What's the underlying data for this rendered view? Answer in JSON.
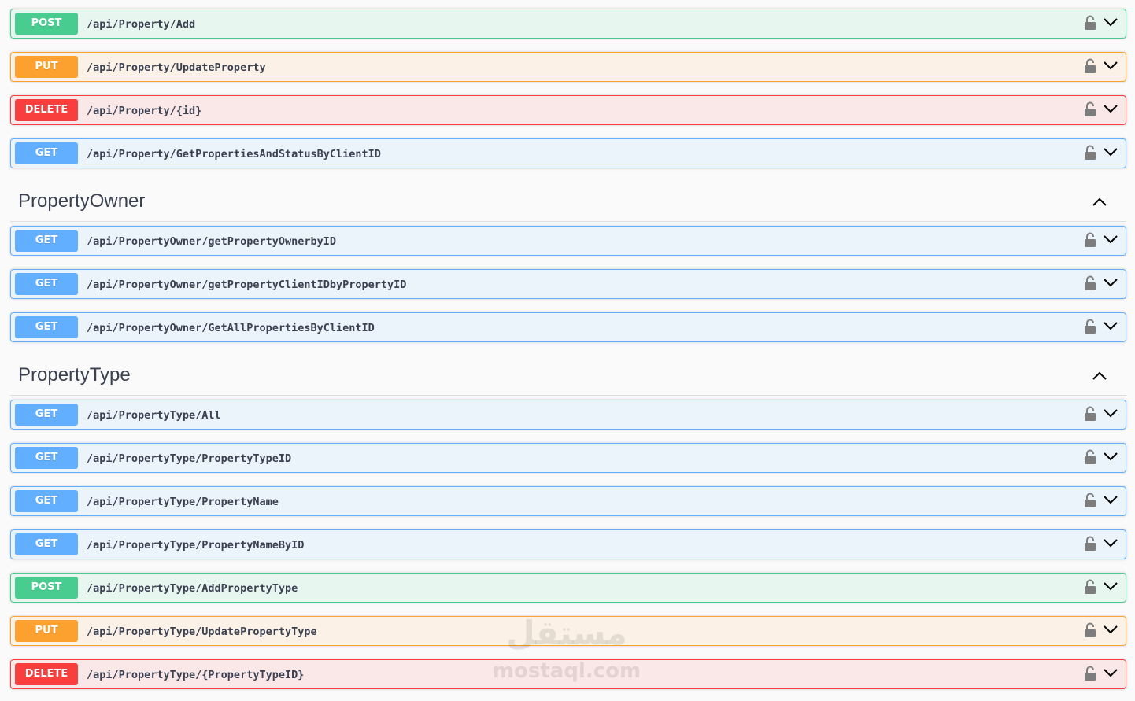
{
  "property_ops": [
    {
      "method": "POST",
      "path": "/api/Property/Add"
    },
    {
      "method": "PUT",
      "path": "/api/Property/UpdateProperty"
    },
    {
      "method": "DELETE",
      "path": "/api/Property/{id}"
    },
    {
      "method": "GET",
      "path": "/api/Property/GetPropertiesAndStatusByClientID"
    }
  ],
  "sections": [
    {
      "title": "PropertyOwner",
      "ops": [
        {
          "method": "GET",
          "path": "/api/PropertyOwner/getPropertyOwnerbyID"
        },
        {
          "method": "GET",
          "path": "/api/PropertyOwner/getPropertyClientIDbyPropertyID"
        },
        {
          "method": "GET",
          "path": "/api/PropertyOwner/GetAllPropertiesByClientID"
        }
      ]
    },
    {
      "title": "PropertyType",
      "ops": [
        {
          "method": "GET",
          "path": "/api/PropertyType/All"
        },
        {
          "method": "GET",
          "path": "/api/PropertyType/PropertyTypeID"
        },
        {
          "method": "GET",
          "path": "/api/PropertyType/PropertyName"
        },
        {
          "method": "GET",
          "path": "/api/PropertyType/PropertyNameByID"
        },
        {
          "method": "POST",
          "path": "/api/PropertyType/AddPropertyType"
        },
        {
          "method": "PUT",
          "path": "/api/PropertyType/UpdatePropertyType"
        },
        {
          "method": "DELETE",
          "path": "/api/PropertyType/{PropertyTypeID}"
        }
      ]
    }
  ],
  "watermark": {
    "arabic": "مستقل",
    "latin": "mostaql.com"
  },
  "colors": {
    "get": "#61affe",
    "post": "#49cc90",
    "put": "#fca130",
    "delete": "#f93e3e",
    "text": "#3b4151",
    "icon": "#7d7d7d"
  },
  "icons": {
    "lock": "unlocked-padlock-icon",
    "expand": "chevron-down-icon",
    "collapse": "chevron-up-icon"
  }
}
